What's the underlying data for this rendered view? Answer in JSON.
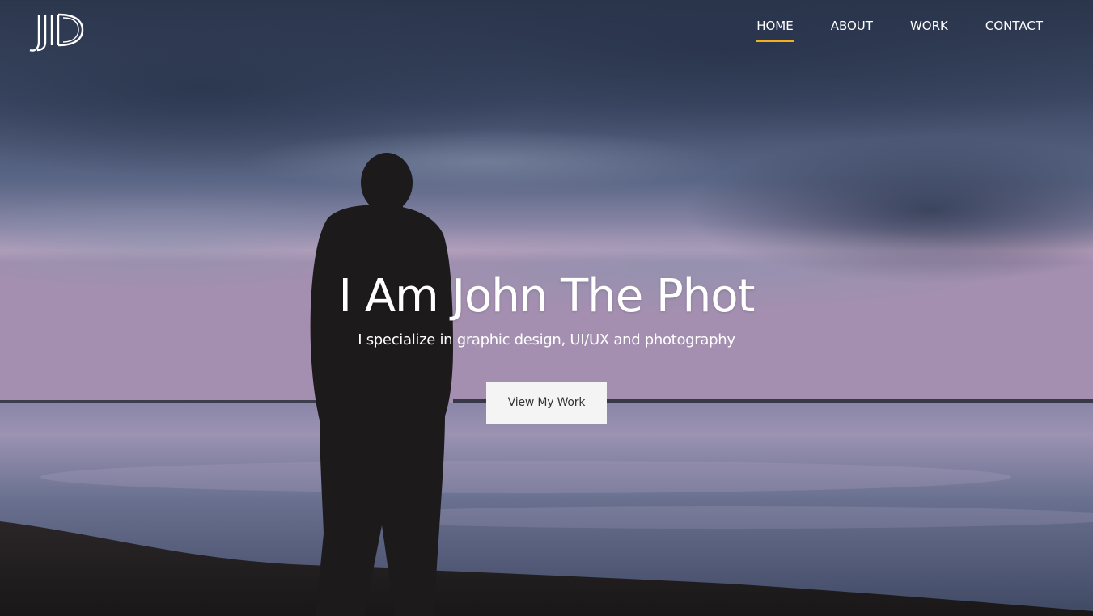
{
  "brand": {
    "logo_text": "JD",
    "icon": "jd-monogram-logo"
  },
  "nav": {
    "items": [
      {
        "label": "HOME",
        "active": true
      },
      {
        "label": "ABOUT",
        "active": false
      },
      {
        "label": "WORK",
        "active": false
      },
      {
        "label": "CONTACT",
        "active": false
      }
    ],
    "active_underline_color": "#f2b01e"
  },
  "hero": {
    "title": "I Am John The Phot",
    "subtitle": "I specialize in graphic design, UI/UX and photography",
    "cta_label": "View My Work",
    "background": "person-silhouette-by-lake-at-dusk"
  },
  "colors": {
    "accent": "#f2b01e",
    "sky_top": "#2e3b55",
    "horizon_pink": "#b39ab8",
    "button_bg": "#f4f4f4"
  }
}
